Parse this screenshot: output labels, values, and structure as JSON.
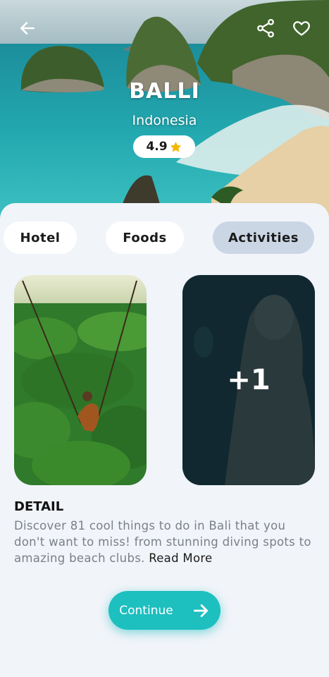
{
  "destination": {
    "name": "BALLI",
    "country": "Indonesia",
    "rating": "4.9"
  },
  "icons": {
    "back": "arrow-left-icon",
    "share": "share-icon",
    "favorite": "heart-icon",
    "star": "star-icon",
    "continue": "arrow-right-icon"
  },
  "tabs": [
    {
      "label": "Hotel"
    },
    {
      "label": "Foods"
    },
    {
      "label": "Activities",
      "active": true
    }
  ],
  "gallery": {
    "more_count": "+1"
  },
  "detail": {
    "title": "DETAIL",
    "text": "Discover 81 cool things to do in Bali that you don't want to miss! from stunning diving spots to amazing beach clubs. ",
    "read_more": "Read More"
  },
  "continue_label": "Continue",
  "colors": {
    "accent": "#1dbfbf",
    "active_tab": "#cbd6e5",
    "star": "#f5b800",
    "background": "#f1f4f9"
  }
}
